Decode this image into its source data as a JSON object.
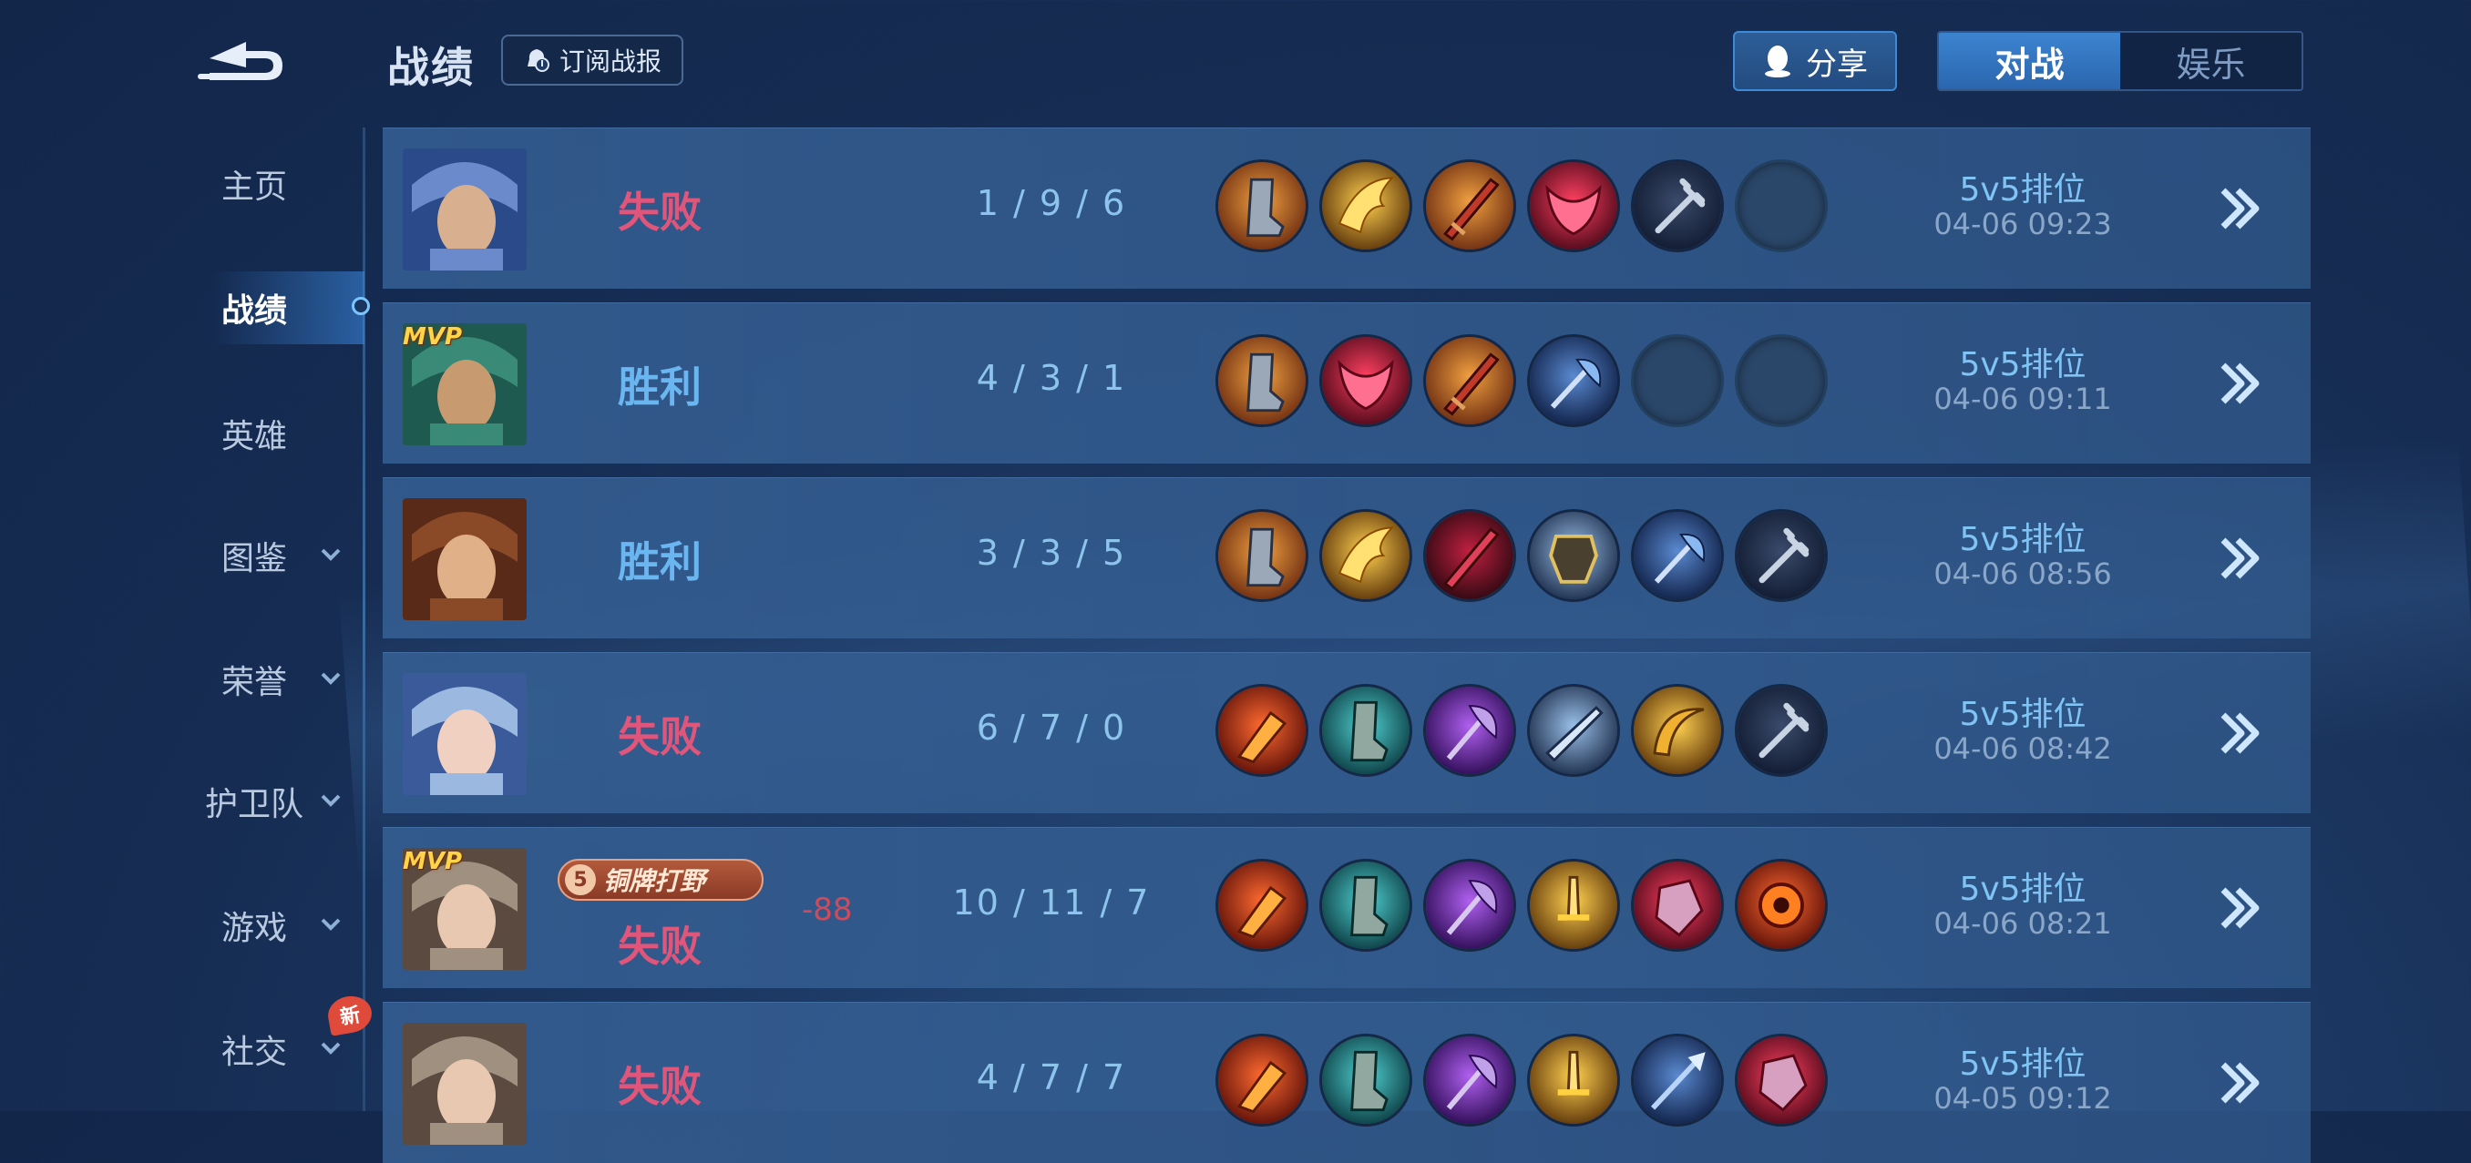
{
  "header": {
    "title": "战绩",
    "subscribe_label": "订阅战报",
    "share_label": "分享",
    "tabs": [
      {
        "label": "对战",
        "active": true
      },
      {
        "label": "娱乐",
        "active": false
      }
    ]
  },
  "sidebar": {
    "items": [
      {
        "label": "主页",
        "active": false,
        "has_chevron": false
      },
      {
        "label": "战绩",
        "active": true,
        "has_chevron": false
      },
      {
        "label": "英雄",
        "active": false,
        "has_chevron": false
      },
      {
        "label": "图鉴",
        "active": false,
        "has_chevron": true
      },
      {
        "label": "荣誉",
        "active": false,
        "has_chevron": true
      },
      {
        "label": "护卫队",
        "active": false,
        "has_chevron": true
      },
      {
        "label": "游戏",
        "active": false,
        "has_chevron": true
      },
      {
        "label": "社交",
        "active": false,
        "has_chevron": true,
        "badge": "新"
      }
    ]
  },
  "colors": {
    "loss": "#e0557a",
    "win": "#6ab6f0",
    "accent": "#3d84d0"
  },
  "matches": [
    {
      "result": "失败",
      "kda": "1 / 9 / 6",
      "mode": "5v5排位",
      "time": "04-06 09:23",
      "mvp": false,
      "items": [
        "boots-icon",
        "flame-wing-icon",
        "red-blade-icon",
        "crimson-mask-icon",
        "trident-icon",
        "empty"
      ]
    },
    {
      "result": "胜利",
      "kda": "4 / 3 / 1",
      "mode": "5v5排位",
      "time": "04-06 09:11",
      "mvp": true,
      "mvp_label": "MVP",
      "items": [
        "boots-icon",
        "crimson-mask-icon",
        "red-blade-icon",
        "blue-axe-icon",
        "empty",
        "empty"
      ]
    },
    {
      "result": "胜利",
      "kda": "3 / 3 / 5",
      "mode": "5v5排位",
      "time": "04-06 08:56",
      "mvp": false,
      "items": [
        "boots-icon",
        "flame-wing-icon",
        "dark-red-blade-icon",
        "armor-icon",
        "blue-axe-icon",
        "trident-icon"
      ]
    },
    {
      "result": "失败",
      "kda": "6 / 7 / 0",
      "mode": "5v5排位",
      "time": "04-06 08:42",
      "mvp": false,
      "items": [
        "red-claw-icon",
        "teal-boots-icon",
        "purple-axe-icon",
        "silver-blade-icon",
        "golden-sickle-icon",
        "trident-icon"
      ]
    },
    {
      "result": "失败",
      "kda": "10 / 11 / 7",
      "mode": "5v5排位",
      "time": "04-06 08:21",
      "mvp": true,
      "mvp_label": "MVP",
      "honor_label": "铜牌打野",
      "score_change": "-88",
      "items": [
        "red-claw-icon",
        "teal-boots-icon",
        "purple-axe-icon",
        "golden-sword-icon",
        "crimson-crystal-icon",
        "fire-orb-icon"
      ]
    },
    {
      "result": "失败",
      "kda": "4 / 7 / 7",
      "mode": "5v5排位",
      "time": "04-05 09:12",
      "mvp": false,
      "items": [
        "red-claw-icon",
        "teal-boots-icon",
        "purple-axe-icon",
        "golden-sword-icon",
        "blue-spear-icon",
        "crimson-crystal-icon"
      ]
    }
  ]
}
